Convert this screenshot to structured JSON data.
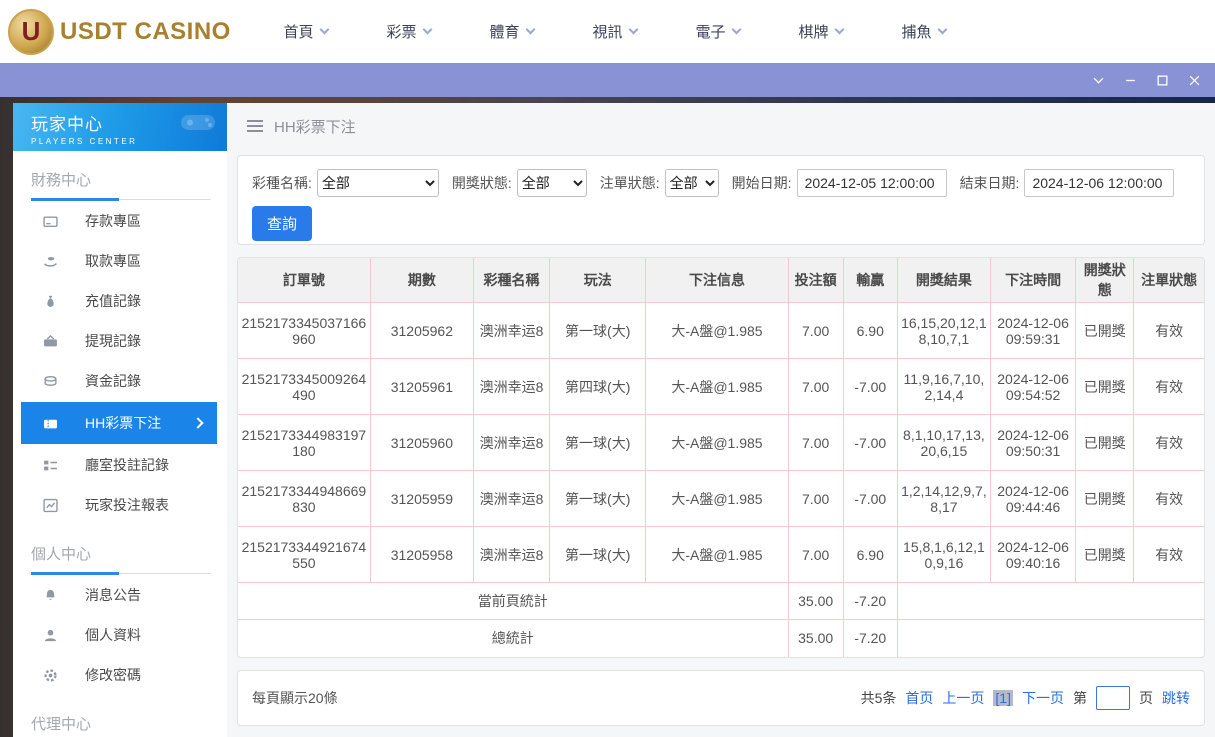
{
  "topnav": {
    "logo_text": "USDT CASINO",
    "logo_letter": "U",
    "items": [
      {
        "label": "首頁"
      },
      {
        "label": "彩票"
      },
      {
        "label": "體育"
      },
      {
        "label": "視訊"
      },
      {
        "label": "電子"
      },
      {
        "label": "棋牌"
      },
      {
        "label": "捕魚"
      }
    ]
  },
  "sidebar": {
    "header": {
      "title": "玩家中心",
      "subtitle": "PLAYERS CENTER"
    },
    "sections": [
      {
        "title": "財務中心",
        "items": [
          {
            "label": "存款專區",
            "icon": "deposit-card-icon"
          },
          {
            "label": "取款專區",
            "icon": "withdraw-hand-icon"
          },
          {
            "label": "充值記錄",
            "icon": "money-bag-icon"
          },
          {
            "label": "提現記錄",
            "icon": "banknote-icon"
          },
          {
            "label": "資金記錄",
            "icon": "coins-icon"
          },
          {
            "label": "HH彩票下注",
            "icon": "ticket-icon",
            "active": true
          },
          {
            "label": "廳室投註記錄",
            "icon": "hall-list-icon"
          },
          {
            "label": "玩家投注報表",
            "icon": "report-chart-icon"
          }
        ]
      },
      {
        "title": "個人中心",
        "items": [
          {
            "label": "消息公告",
            "icon": "bell-icon"
          },
          {
            "label": "個人資料",
            "icon": "user-icon"
          },
          {
            "label": "修改密碼",
            "icon": "gear-icon"
          }
        ]
      },
      {
        "title": "代理中心",
        "items": []
      }
    ]
  },
  "breadcrumb": {
    "title": "HH彩票下注"
  },
  "filters": {
    "lottery_label": "彩種名稱:",
    "lottery_value": "全部",
    "draw_status_label": "開獎狀態:",
    "draw_status_value": "全部",
    "order_status_label": "注單狀態:",
    "order_status_value": "全部",
    "start_date_label": "開始日期:",
    "start_date_value": "2024-12-05 12:00:00",
    "end_date_label": "結束日期:",
    "end_date_value": "2024-12-06 12:00:00",
    "query_label": "查詢"
  },
  "table": {
    "headers": [
      "訂單號",
      "期數",
      "彩種名稱",
      "玩法",
      "下注信息",
      "投注額",
      "輸贏",
      "開獎結果",
      "下注時間",
      "開獎狀態",
      "注單狀態"
    ],
    "rows": [
      [
        "2152173345037166960",
        "31205962",
        "澳洲幸运8",
        "第一球(大)",
        "大-A盤@1.985",
        "7.00",
        "6.90",
        "16,15,20,12,18,10,7,1",
        "2024-12-06 09:59:31",
        "已開獎",
        "有效"
      ],
      [
        "2152173345009264490",
        "31205961",
        "澳洲幸运8",
        "第四球(大)",
        "大-A盤@1.985",
        "7.00",
        "-7.00",
        "11,9,16,7,10,2,14,4",
        "2024-12-06 09:54:52",
        "已開獎",
        "有效"
      ],
      [
        "2152173344983197180",
        "31205960",
        "澳洲幸运8",
        "第一球(大)",
        "大-A盤@1.985",
        "7.00",
        "-7.00",
        "8,1,10,17,13,20,6,15",
        "2024-12-06 09:50:31",
        "已開獎",
        "有效"
      ],
      [
        "2152173344948669830",
        "31205959",
        "澳洲幸运8",
        "第一球(大)",
        "大-A盤@1.985",
        "7.00",
        "-7.00",
        "1,2,14,12,9,7,8,17",
        "2024-12-06 09:44:46",
        "已開獎",
        "有效"
      ],
      [
        "2152173344921674550",
        "31205958",
        "澳洲幸运8",
        "第一球(大)",
        "大-A盤@1.985",
        "7.00",
        "6.90",
        "15,8,1,6,12,10,9,16",
        "2024-12-06 09:40:16",
        "已開獎",
        "有效"
      ]
    ],
    "summary": [
      {
        "label": "當前頁統計",
        "bet_total": "35.00",
        "win_loss_total": "-7.20"
      },
      {
        "label": "總統計",
        "bet_total": "35.00",
        "win_loss_total": "-7.20"
      }
    ]
  },
  "pagination": {
    "page_size_text": "每頁顯示20條",
    "total_text": "共5条",
    "first_label": "首页",
    "prev_label": "上一页",
    "current_page": "[1]",
    "next_label": "下一页",
    "jump_prefix": "第",
    "jump_suffix": "页",
    "jump_button": "跳转"
  },
  "colors": {
    "accent_blue": "#1b84e8",
    "button_blue": "#2a7bea",
    "link_blue": "#2a6ee0",
    "titlebar_purple": "#8a92d6",
    "gold": "#a9802e",
    "table_border_pink": "#f3cbcb",
    "sidebar_header_blue": "#1f9ce8"
  }
}
